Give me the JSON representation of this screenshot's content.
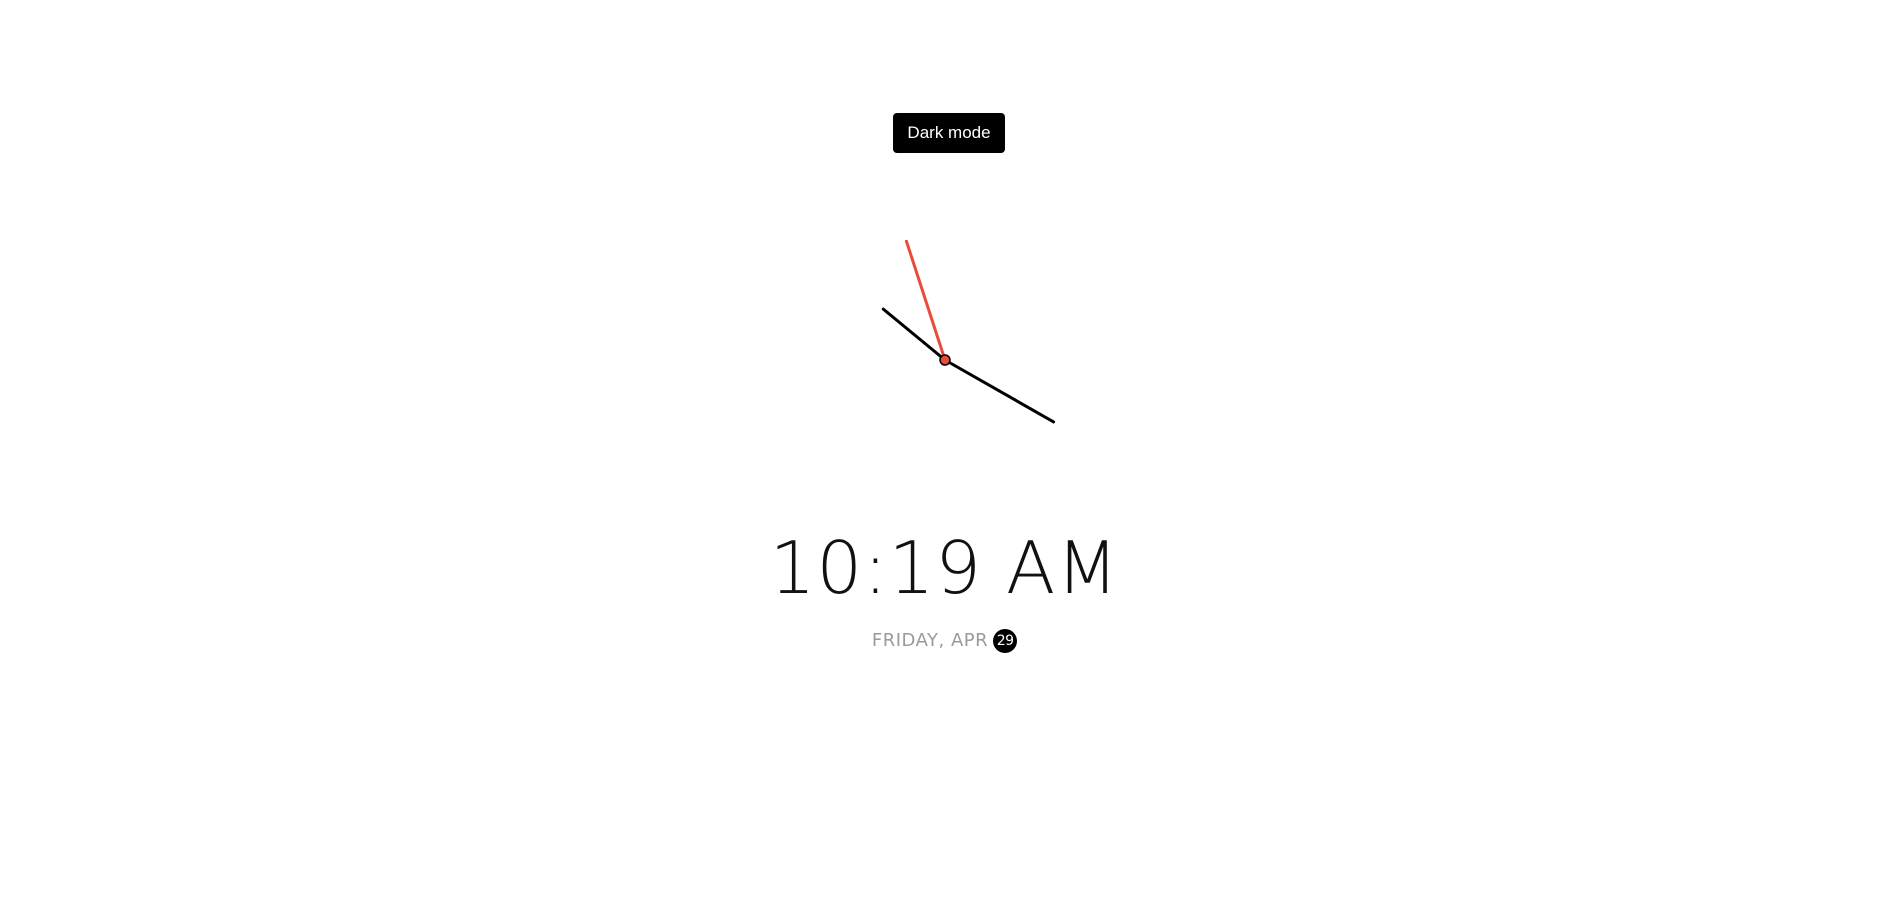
{
  "theme_toggle": {
    "label": "Dark mode"
  },
  "clock": {
    "hour": 10,
    "minute": 19,
    "second": 57,
    "hand_color": "#000000",
    "second_hand_color": "#e74c3c"
  },
  "digital": {
    "time": "10:19 AM"
  },
  "date": {
    "weekday_month": "FRIDAY, APR",
    "day": "29"
  }
}
